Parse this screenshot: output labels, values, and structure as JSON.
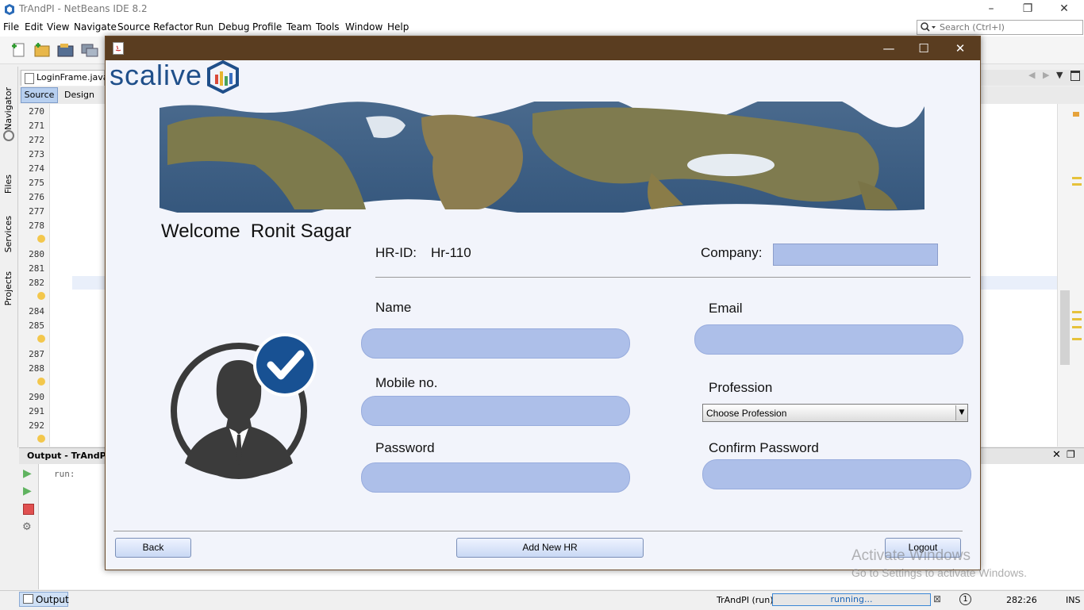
{
  "ide": {
    "title": "TrAndPI - NetBeans IDE 8.2",
    "menu": [
      "File",
      "Edit",
      "View",
      "Navigate",
      "Source",
      "Refactor",
      "Run",
      "Debug",
      "Profile",
      "Team",
      "Tools",
      "Window",
      "Help"
    ],
    "search_placeholder": "Search (Ctrl+I)",
    "file_tab": "LoginFrame.java",
    "source_tab": "Source",
    "design_tab": "Design",
    "side_tabs": [
      "Navigator",
      "Files",
      "Services",
      "Projects"
    ],
    "line_numbers": [
      "270",
      "271",
      "272",
      "273",
      "274",
      "275",
      "276",
      "277",
      "278",
      "",
      "280",
      "281",
      "282",
      "",
      "284",
      "285",
      "",
      "287",
      "288",
      "",
      "290",
      "291",
      "292",
      ""
    ],
    "output_title": "Output - TrAndPI (",
    "output_text": "run:",
    "output_tab": "Output",
    "status_project": "TrAndPI (run)",
    "status_progress": "running...",
    "status_position": "282:26",
    "status_mode": "INS",
    "status_badge": "1"
  },
  "app": {
    "logo_text": "scalive",
    "welcome": "Welcome  Ronit Sagar",
    "hr_id_label": "HR-ID:",
    "hr_id_value": "Hr-110",
    "company_label": "Company:",
    "company_value": "",
    "name_label": "Name",
    "email_label": "Email",
    "mobile_label": "Mobile no.",
    "profession_label": "Profession",
    "profession_selected": "Choose Profession",
    "password_label": "Password",
    "confirm_password_label": "Confirm Password",
    "back_button": "Back",
    "add_button": "Add New HR",
    "logout_button": "Logout"
  },
  "watermark": {
    "line1": "Activate Windows",
    "line2": "Go to Settings to activate Windows."
  },
  "colors": {
    "frame_titlebar": "#5a3d20",
    "field_fill": "#adbfe9",
    "brand_blue": "#1f5a98"
  }
}
